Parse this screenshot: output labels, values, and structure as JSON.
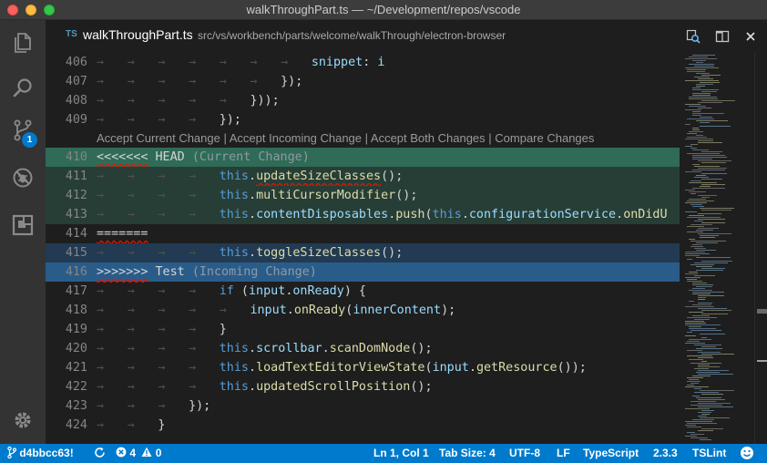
{
  "window": {
    "title": "walkThroughPart.ts — ~/Development/repos/vscode"
  },
  "activity": {
    "items": [
      "explorer",
      "search",
      "source-control",
      "debug",
      "extensions"
    ],
    "scm_badge": "1"
  },
  "tab": {
    "lang": "TS",
    "title": "walkThroughPart.ts",
    "path": "src/vs/workbench/parts/welcome/walkThrough/electron-browser"
  },
  "codelens": {
    "accept_current": "Accept Current Change",
    "accept_incoming": "Accept Incoming Change",
    "accept_both": "Accept Both Changes",
    "compare": "Compare Changes",
    "sep": " | "
  },
  "lines": [
    {
      "n": "406",
      "indent": 7,
      "parts": [
        {
          "t": "snippet",
          "c": "prop"
        },
        {
          "t": ": ",
          "c": "plain"
        },
        {
          "t": "i",
          "c": "prop"
        }
      ]
    },
    {
      "n": "407",
      "indent": 6,
      "parts": [
        {
          "t": "});",
          "c": "plain"
        }
      ]
    },
    {
      "n": "408",
      "indent": 5,
      "parts": [
        {
          "t": "}));",
          "c": "plain"
        }
      ]
    },
    {
      "n": "409",
      "indent": 4,
      "parts": [
        {
          "t": "});",
          "c": "plain"
        }
      ]
    },
    {
      "codelens": true
    },
    {
      "n": "410",
      "bg": "current-h",
      "indent": 0,
      "parts": [
        {
          "t": "<<<<<<<",
          "c": "marker squig"
        },
        {
          "t": " HEAD ",
          "c": "plain"
        },
        {
          "t": "(Current Change)",
          "c": "label-dim"
        }
      ]
    },
    {
      "n": "411",
      "bg": "current",
      "indent": 4,
      "parts": [
        {
          "t": "this",
          "c": "kw"
        },
        {
          "t": ".",
          "c": "plain"
        },
        {
          "t": "updateSizeClasses",
          "c": "fn squig"
        },
        {
          "t": "();",
          "c": "plain"
        }
      ]
    },
    {
      "n": "412",
      "bg": "current",
      "indent": 4,
      "parts": [
        {
          "t": "this",
          "c": "kw"
        },
        {
          "t": ".",
          "c": "plain"
        },
        {
          "t": "multiCursorModifier",
          "c": "fn"
        },
        {
          "t": "();",
          "c": "plain"
        }
      ]
    },
    {
      "n": "413",
      "bg": "current",
      "indent": 4,
      "parts": [
        {
          "t": "this",
          "c": "kw"
        },
        {
          "t": ".",
          "c": "plain"
        },
        {
          "t": "contentDisposables",
          "c": "prop"
        },
        {
          "t": ".",
          "c": "plain"
        },
        {
          "t": "push",
          "c": "fn"
        },
        {
          "t": "(",
          "c": "plain"
        },
        {
          "t": "this",
          "c": "kw"
        },
        {
          "t": ".",
          "c": "plain"
        },
        {
          "t": "configurationService",
          "c": "prop"
        },
        {
          "t": ".",
          "c": "plain"
        },
        {
          "t": "onDidU",
          "c": "fn"
        }
      ]
    },
    {
      "n": "414",
      "indent": 0,
      "parts": [
        {
          "t": "=======",
          "c": "plain squig"
        }
      ]
    },
    {
      "n": "415",
      "bg": "incoming",
      "indent": 4,
      "parts": [
        {
          "t": "this",
          "c": "kw"
        },
        {
          "t": ".",
          "c": "plain"
        },
        {
          "t": "toggleSizeClasses",
          "c": "fn"
        },
        {
          "t": "();",
          "c": "plain"
        }
      ]
    },
    {
      "n": "416",
      "bg": "incoming-h",
      "indent": 0,
      "parts": [
        {
          "t": ">>>>>>>",
          "c": "marker squig"
        },
        {
          "t": " Test ",
          "c": "plain"
        },
        {
          "t": "(Incoming Change)",
          "c": "label-dim"
        }
      ]
    },
    {
      "n": "417",
      "indent": 4,
      "parts": [
        {
          "t": "if",
          "c": "kw"
        },
        {
          "t": " (",
          "c": "plain"
        },
        {
          "t": "input",
          "c": "prop"
        },
        {
          "t": ".",
          "c": "plain"
        },
        {
          "t": "onReady",
          "c": "prop"
        },
        {
          "t": ") {",
          "c": "plain"
        }
      ]
    },
    {
      "n": "418",
      "indent": 5,
      "parts": [
        {
          "t": "input",
          "c": "prop"
        },
        {
          "t": ".",
          "c": "plain"
        },
        {
          "t": "onReady",
          "c": "fn"
        },
        {
          "t": "(",
          "c": "plain"
        },
        {
          "t": "innerContent",
          "c": "prop"
        },
        {
          "t": ");",
          "c": "plain"
        }
      ]
    },
    {
      "n": "419",
      "indent": 4,
      "parts": [
        {
          "t": "}",
          "c": "plain"
        }
      ]
    },
    {
      "n": "420",
      "indent": 4,
      "parts": [
        {
          "t": "this",
          "c": "kw"
        },
        {
          "t": ".",
          "c": "plain"
        },
        {
          "t": "scrollbar",
          "c": "prop"
        },
        {
          "t": ".",
          "c": "plain"
        },
        {
          "t": "scanDomNode",
          "c": "fn"
        },
        {
          "t": "();",
          "c": "plain"
        }
      ]
    },
    {
      "n": "421",
      "indent": 4,
      "parts": [
        {
          "t": "this",
          "c": "kw"
        },
        {
          "t": ".",
          "c": "plain"
        },
        {
          "t": "loadTextEditorViewState",
          "c": "fn"
        },
        {
          "t": "(",
          "c": "plain"
        },
        {
          "t": "input",
          "c": "prop"
        },
        {
          "t": ".",
          "c": "plain"
        },
        {
          "t": "getResource",
          "c": "fn"
        },
        {
          "t": "());",
          "c": "plain"
        }
      ]
    },
    {
      "n": "422",
      "indent": 4,
      "parts": [
        {
          "t": "this",
          "c": "kw"
        },
        {
          "t": ".",
          "c": "plain"
        },
        {
          "t": "updatedScrollPosition",
          "c": "fn"
        },
        {
          "t": "();",
          "c": "plain"
        }
      ]
    },
    {
      "n": "423",
      "indent": 3,
      "parts": [
        {
          "t": "});",
          "c": "plain"
        }
      ]
    },
    {
      "n": "424",
      "indent": 2,
      "parts": [
        {
          "t": "}",
          "c": "plain"
        }
      ]
    }
  ],
  "status": {
    "branch": "d4bbcc63!",
    "errors": "4",
    "warnings": "0",
    "position": "Ln 1, Col 1",
    "tab_size": "Tab Size: 4",
    "encoding": "UTF-8",
    "eol": "LF",
    "language": "TypeScript",
    "ts_version": "2.3.3",
    "linter": "TSLint"
  },
  "colors": {
    "accent": "#007acc",
    "current_header": "#2f6b57",
    "incoming_header": "#2a5c8a"
  }
}
